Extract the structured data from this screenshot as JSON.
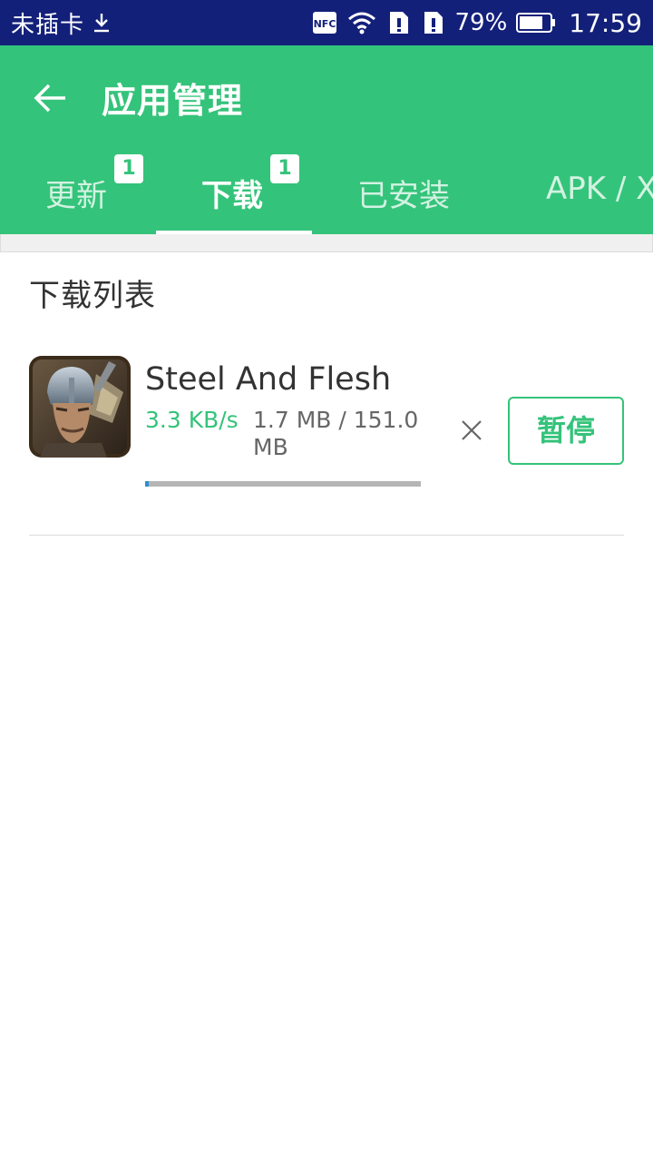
{
  "status_bar": {
    "carrier": "未插卡",
    "battery_percent": "79%",
    "battery_level": 0.79,
    "time": "17:59",
    "icons": [
      "download-icon",
      "nfc-icon",
      "wifi-icon",
      "sim-alert-icon",
      "sim-alert-icon",
      "battery-icon"
    ]
  },
  "app_bar": {
    "title": "应用管理",
    "back_icon": "arrow-left-icon",
    "background": "#34c37a"
  },
  "tabs": [
    {
      "label": "更新",
      "badge": "1",
      "active": false
    },
    {
      "label": "下载",
      "badge": "1",
      "active": true
    },
    {
      "label": "已安装",
      "badge": "",
      "active": false
    },
    {
      "label": "APK / X",
      "badge": "",
      "active": false
    }
  ],
  "section": {
    "title": "下载列表"
  },
  "downloads": [
    {
      "name": "Steel And Flesh",
      "speed": "3.3 KB/s",
      "size": "1.7 MB / 151.0 MB",
      "progress": 0.011,
      "pause_label": "暂停",
      "cancel_icon": "close-icon"
    }
  ],
  "colors": {
    "accent": "#34c37a",
    "status_bar": "#13207a",
    "progress": "#2c8fd0"
  }
}
